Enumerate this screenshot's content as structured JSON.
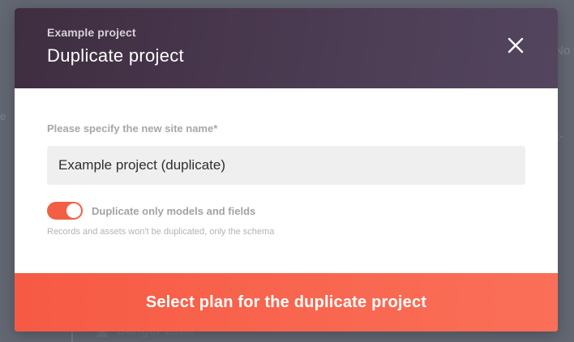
{
  "background": {
    "right_text_1": "No",
    "right_text_2": "t-",
    "left_text_1": "e",
    "bottom_section": "Danger zone"
  },
  "modal": {
    "subtitle": "Example project",
    "title": "Duplicate project",
    "close_icon": "close-icon",
    "site_name_label": "Please specify the new site name*",
    "site_name_value": "Example project (duplicate)",
    "toggle": {
      "label": "Duplicate only models and fields",
      "checked": true,
      "hint": "Records and assets won't be duplicated, only the schema"
    },
    "cta_label": "Select plan for the duplicate project"
  },
  "colors": {
    "header_dark": "#3f2d40",
    "accent": "#f65a44",
    "input_bg": "#efefef"
  }
}
